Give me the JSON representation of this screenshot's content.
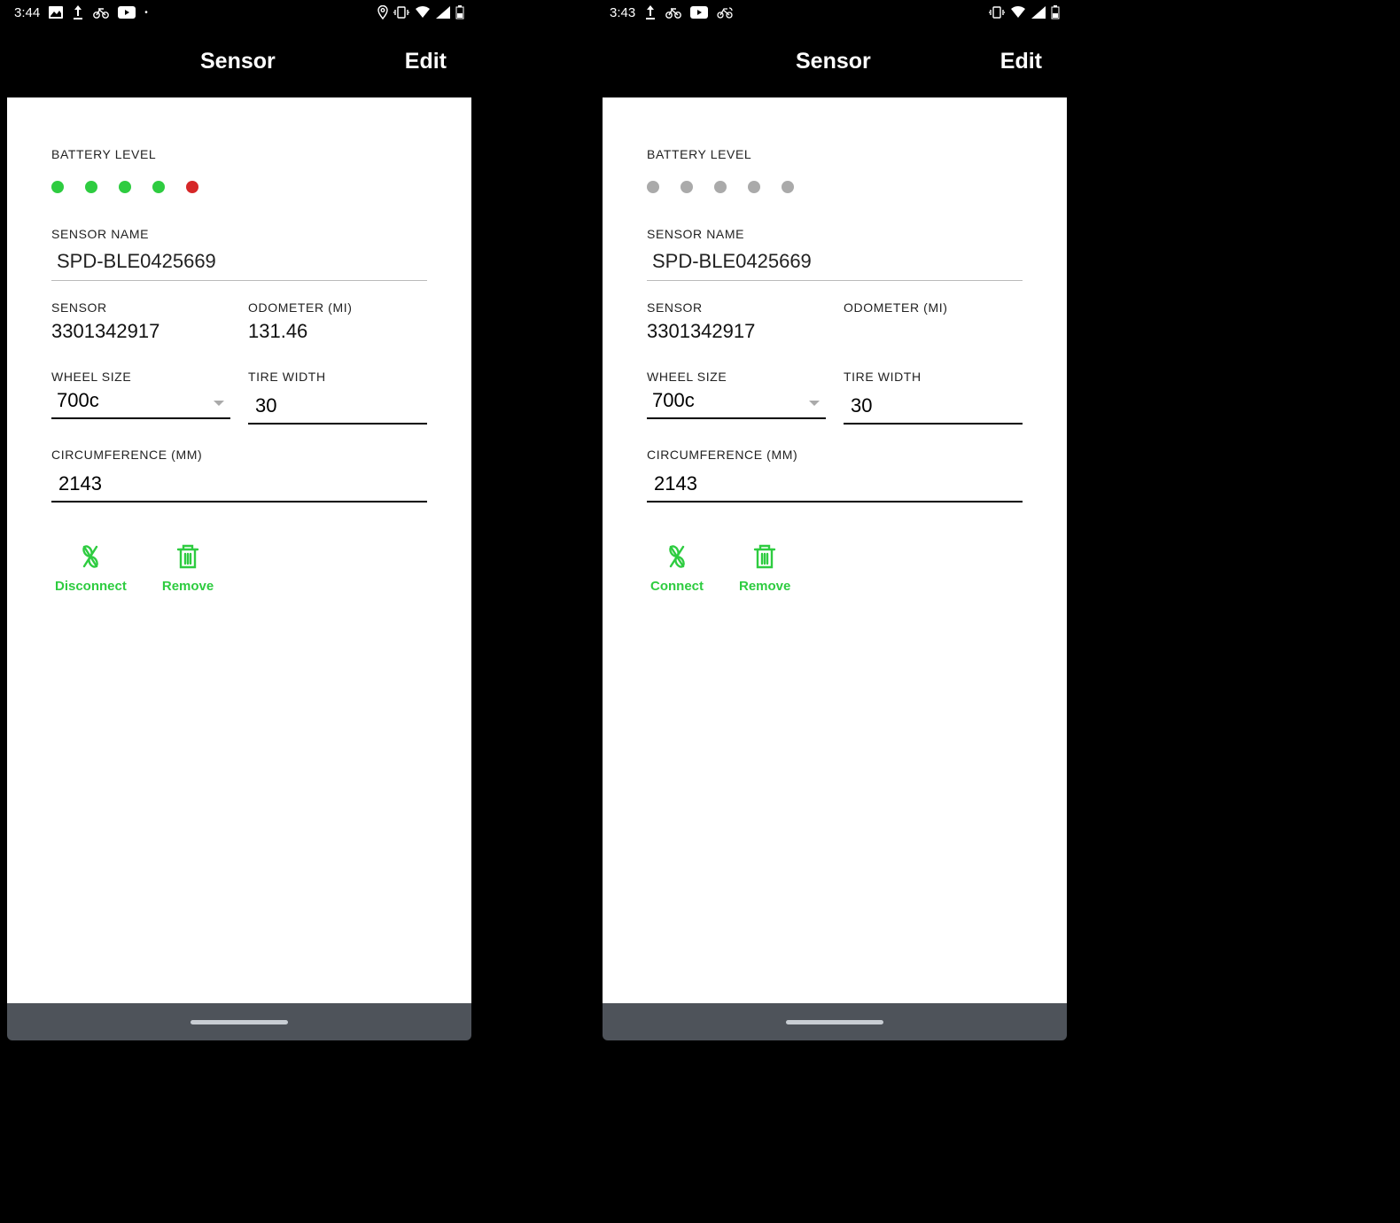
{
  "screens": [
    {
      "status": {
        "time": "3:44",
        "icons_left": [
          "image",
          "upload",
          "bike",
          "youtube",
          "dot"
        ],
        "icons_right": [
          "location",
          "vibrate",
          "wifi",
          "signal",
          "battery"
        ]
      },
      "header": {
        "title": "Sensor",
        "edit": "Edit"
      },
      "battery": {
        "label": "BATTERY LEVEL",
        "dots": [
          "green",
          "green",
          "green",
          "green",
          "red"
        ]
      },
      "sensor_name": {
        "label": "SENSOR NAME",
        "value": "SPD-BLE0425669"
      },
      "sensor": {
        "label": "SENSOR",
        "value": "3301342917"
      },
      "odometer": {
        "label": "ODOMETER (MI)",
        "value": "131.46"
      },
      "wheel_size": {
        "label": "WHEEL SIZE",
        "value": "700c"
      },
      "tire_width": {
        "label": "TIRE WIDTH",
        "value": "30"
      },
      "circumference": {
        "label": "CIRCUMFERENCE (MM)",
        "value": "2143"
      },
      "actions": {
        "primary": "Disconnect",
        "remove": "Remove"
      }
    },
    {
      "status": {
        "time": "3:43",
        "icons_left": [
          "upload",
          "bike",
          "youtube",
          "bike-alt"
        ],
        "icons_right": [
          "vibrate",
          "wifi",
          "signal",
          "battery"
        ]
      },
      "header": {
        "title": "Sensor",
        "edit": "Edit"
      },
      "battery": {
        "label": "BATTERY LEVEL",
        "dots": [
          "gray",
          "gray",
          "gray",
          "gray",
          "gray"
        ]
      },
      "sensor_name": {
        "label": "SENSOR NAME",
        "value": "SPD-BLE0425669"
      },
      "sensor": {
        "label": "SENSOR",
        "value": "3301342917"
      },
      "odometer": {
        "label": "ODOMETER (MI)",
        "value": ""
      },
      "wheel_size": {
        "label": "WHEEL SIZE",
        "value": "700c"
      },
      "tire_width": {
        "label": "TIRE WIDTH",
        "value": "30"
      },
      "circumference": {
        "label": "CIRCUMFERENCE (MM)",
        "value": "2143"
      },
      "actions": {
        "primary": "Connect",
        "remove": "Remove"
      }
    }
  ]
}
